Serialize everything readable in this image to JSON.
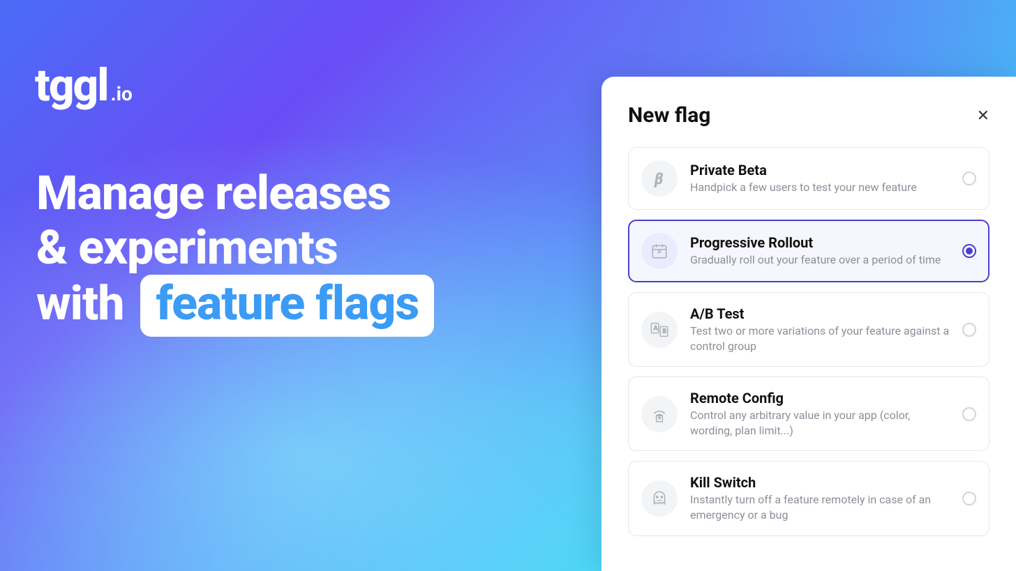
{
  "logo": {
    "main": "tggl",
    "sub": ".io"
  },
  "headline": {
    "line1": "Manage releases",
    "line2": "& experiments",
    "line3": "with",
    "highlight": "feature flags"
  },
  "panel": {
    "title": "New flag",
    "options": [
      {
        "title": "Private Beta",
        "desc": "Handpick a few users to test your new feature",
        "selected": false
      },
      {
        "title": "Progressive Rollout",
        "desc": "Gradually roll out your feature over a period of time",
        "selected": true
      },
      {
        "title": "A/B Test",
        "desc": "Test two or more variations of your feature against a control group",
        "selected": false
      },
      {
        "title": "Remote Config",
        "desc": "Control any arbitrary value in your app (color, wording, plan limit...)",
        "selected": false
      },
      {
        "title": "Kill Switch",
        "desc": "Instantly turn off a feature remotely in case of an emergency or a bug",
        "selected": false
      }
    ]
  }
}
